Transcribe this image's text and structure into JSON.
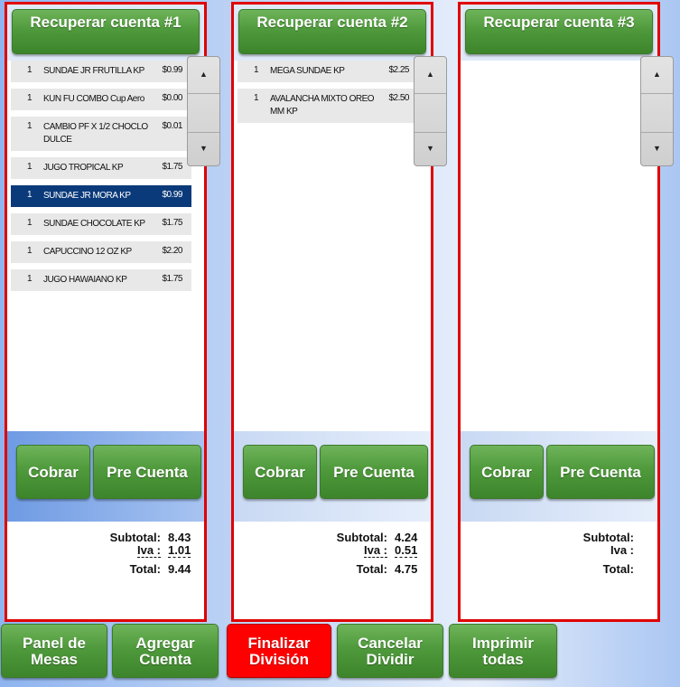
{
  "accounts": [
    {
      "title": "Recuperar cuenta #1",
      "items": [
        {
          "qty": "1",
          "name": "SUNDAE JR FRUTILLA KP",
          "price": "$0.99",
          "selected": false
        },
        {
          "qty": "1",
          "name": "KUN FU COMBO Cup Aero",
          "price": "$0.00",
          "selected": false
        },
        {
          "qty": "1",
          "name": "CAMBIO PF X 1/2 CHOCLO DULCE",
          "price": "$0.01",
          "selected": false
        },
        {
          "qty": "1",
          "name": "JUGO TROPICAL KP",
          "price": "$1.75",
          "selected": false
        },
        {
          "qty": "1",
          "name": "SUNDAE JR MORA KP",
          "price": "$0.99",
          "selected": true
        },
        {
          "qty": "1",
          "name": "SUNDAE CHOCOLATE KP",
          "price": "$1.75",
          "selected": false
        },
        {
          "qty": "1",
          "name": "CAPUCCINO 12 OZ KP",
          "price": "$2.20",
          "selected": false
        },
        {
          "qty": "1",
          "name": "JUGO HAWAIANO KP",
          "price": "$1.75",
          "selected": false
        }
      ],
      "cobrar_label": "Cobrar",
      "precuenta_label": "Pre Cuenta",
      "subtotal_label": "Subtotal:",
      "iva_label": "Iva :",
      "total_label": "Total:",
      "subtotal": "8.43",
      "iva": "1.01",
      "total": "9.44"
    },
    {
      "title": "Recuperar cuenta #2",
      "items": [
        {
          "qty": "1",
          "name": "MEGA SUNDAE KP",
          "price": "$2.25",
          "selected": false
        },
        {
          "qty": "1",
          "name": "AVALANCHA MIXTO OREO MM KP",
          "price": "$2.50",
          "selected": false
        }
      ],
      "cobrar_label": "Cobrar",
      "precuenta_label": "Pre Cuenta",
      "subtotal_label": "Subtotal:",
      "iva_label": "Iva :",
      "total_label": "Total:",
      "subtotal": "4.24",
      "iva": "0.51",
      "total": "4.75"
    },
    {
      "title": "Recuperar cuenta #3",
      "items": [],
      "cobrar_label": "Cobrar",
      "precuenta_label": "Pre Cuenta",
      "subtotal_label": "Subtotal:",
      "iva_label": "Iva :",
      "total_label": "Total:",
      "subtotal": "",
      "iva": "",
      "total": ""
    }
  ],
  "scroll_icons": {
    "up": "triangle-up-icon",
    "down": "triangle-down-icon"
  },
  "bottom_bar": {
    "panel_mesas": "Panel de Mesas",
    "agregar_cuenta": "Agregar Cuenta",
    "finalizar_division": "Finalizar División",
    "cancelar_dividir": "Cancelar Dividir",
    "imprimir_todas": "Imprimir todas"
  },
  "colors": {
    "panel_border": "#e00000",
    "green": "#4f9a3c",
    "selected_row": "#0b3a7a",
    "finalizar": "#ff0000"
  }
}
